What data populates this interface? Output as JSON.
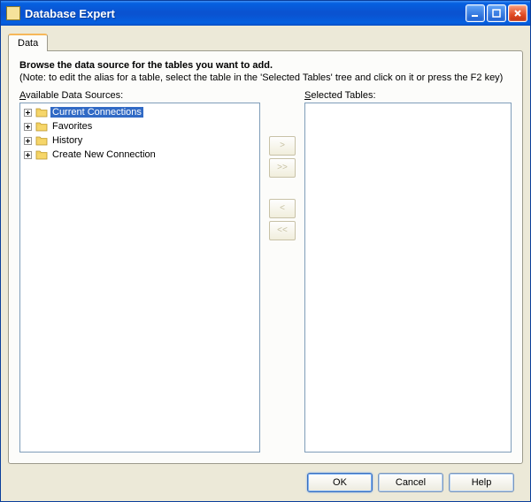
{
  "window": {
    "title": "Database Expert"
  },
  "tabs": [
    {
      "label": "Data",
      "active": true
    }
  ],
  "instructions": {
    "title": "Browse the data source for the tables you want to add.",
    "note": "(Note: to edit the alias for a table, select the table in the 'Selected Tables' tree and click on it or press the F2 key)"
  },
  "available": {
    "label_pre": "A",
    "label_rest": "vailable Data Sources:",
    "items": [
      {
        "label": "Current Connections",
        "selected": true
      },
      {
        "label": "Favorites",
        "selected": false
      },
      {
        "label": "History",
        "selected": false
      },
      {
        "label": "Create New Connection",
        "selected": false
      }
    ]
  },
  "selected": {
    "label_pre": "S",
    "label_rest": "elected Tables:"
  },
  "move_buttons": {
    "add": ">",
    "addAll": ">>",
    "remove": "<",
    "removeAll": "<<"
  },
  "footer": {
    "ok": "OK",
    "cancel": "Cancel",
    "help": "Help"
  }
}
